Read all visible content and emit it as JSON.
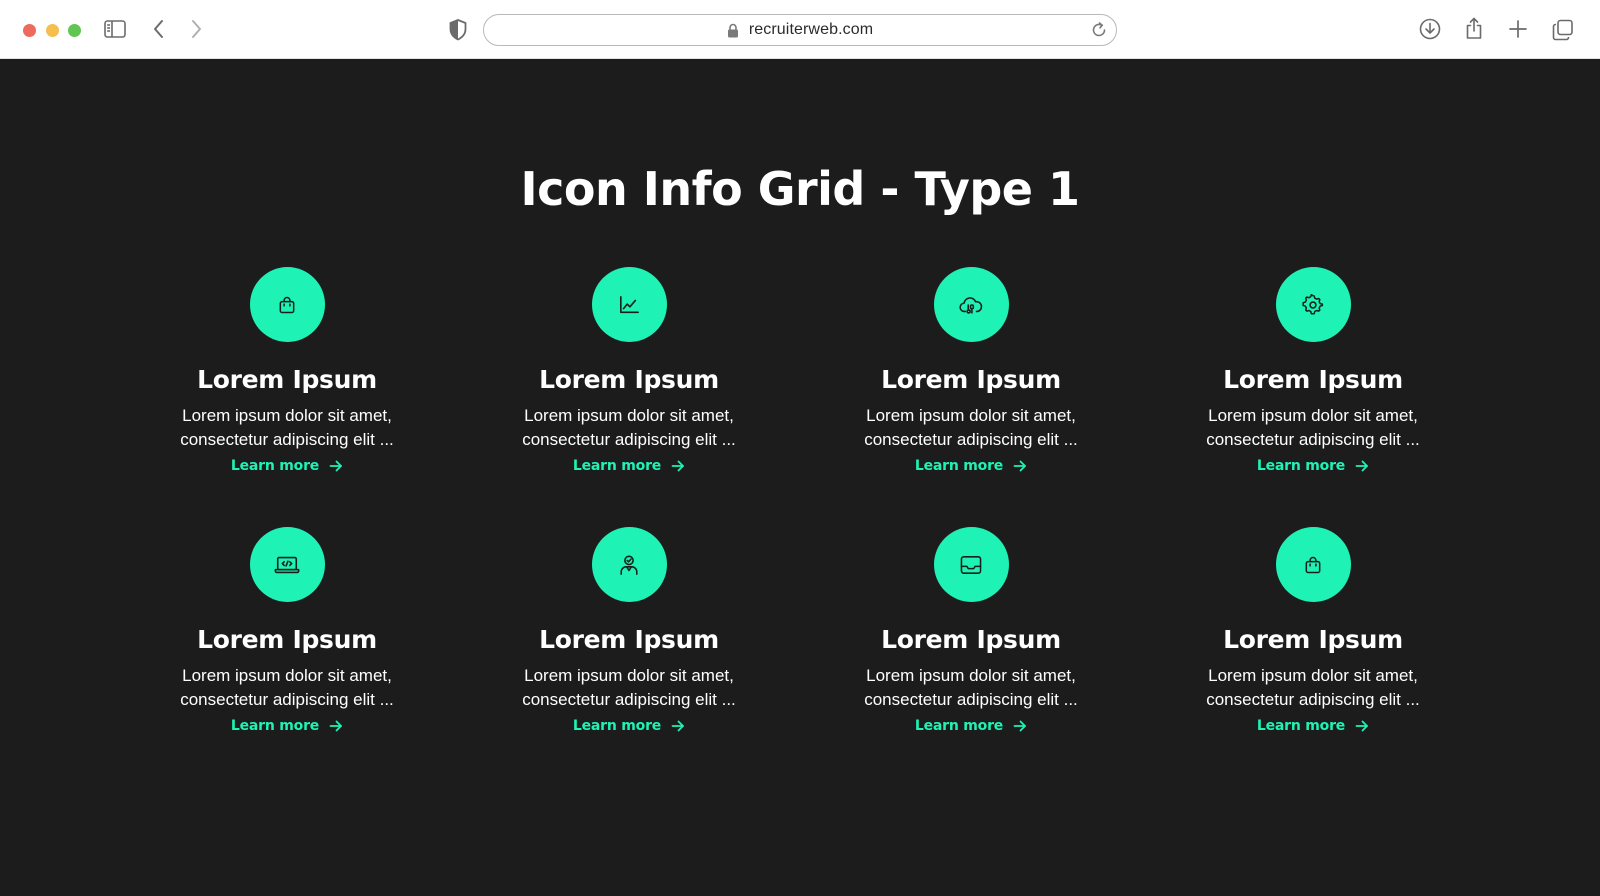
{
  "browser": {
    "url": "recruiterweb.com"
  },
  "page": {
    "title": "Icon Info Grid - Type 1"
  },
  "cards": [
    {
      "icon": "shopping-bag-icon",
      "title": "Lorem Ipsum",
      "description": "Lorem ipsum dolor sit amet, consectetur adipiscing elit ...",
      "link": "Learn more"
    },
    {
      "icon": "line-chart-icon",
      "title": "Lorem Ipsum",
      "description": "Lorem ipsum dolor sit amet, consectetur adipiscing elit ...",
      "link": "Learn more"
    },
    {
      "icon": "cloud-data-icon",
      "title": "Lorem Ipsum",
      "description": "Lorem ipsum dolor sit amet, consectetur adipiscing elit ...",
      "link": "Learn more"
    },
    {
      "icon": "gear-icon",
      "title": "Lorem Ipsum",
      "description": "Lorem ipsum dolor sit amet, consectetur adipiscing elit ...",
      "link": "Learn more"
    },
    {
      "icon": "laptop-code-icon",
      "title": "Lorem Ipsum",
      "description": "Lorem ipsum dolor sit amet, consectetur adipiscing elit ...",
      "link": "Learn more"
    },
    {
      "icon": "user-verified-icon",
      "title": "Lorem Ipsum",
      "description": "Lorem ipsum dolor sit amet, consectetur adipiscing elit ...",
      "link": "Learn more"
    },
    {
      "icon": "inbox-tray-icon",
      "title": "Lorem Ipsum",
      "description": "Lorem ipsum dolor sit amet, consectetur adipiscing elit ...",
      "link": "Learn more"
    },
    {
      "icon": "shopping-bag-icon",
      "title": "Lorem Ipsum",
      "description": "Lorem ipsum dolor sit amet, consectetur adipiscing elit ...",
      "link": "Learn more"
    }
  ],
  "colors": {
    "accent": "#1ef2b5",
    "background": "#1c1c1c",
    "text": "#ffffff"
  }
}
